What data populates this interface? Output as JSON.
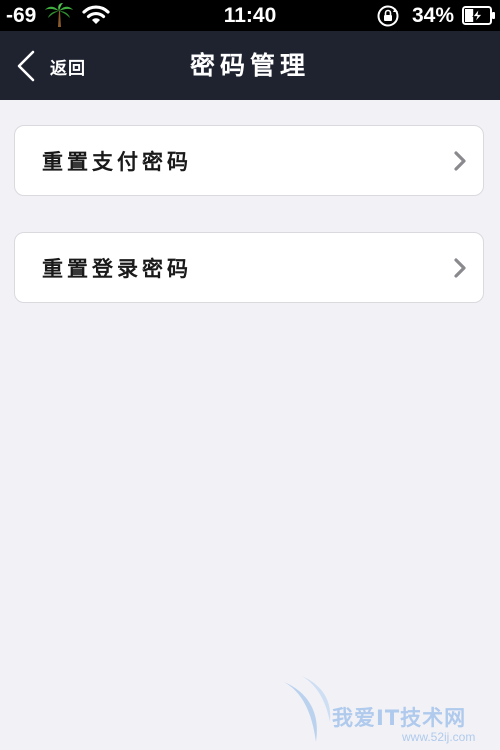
{
  "status_bar": {
    "signal": "-69",
    "carrier_icon": "palm-tree-icon",
    "wifi_icon": "wifi-icon",
    "time": "11:40",
    "lock_icon": "rotation-lock-icon",
    "battery_percent": "34%",
    "battery_icon": "battery-charging-icon",
    "battery_level": 0.34
  },
  "nav_bar": {
    "back_label": "返回",
    "title": "密码管理"
  },
  "menu": {
    "items": [
      {
        "label": "重置支付密码",
        "icon": "chevron-right-icon"
      },
      {
        "label": "重置登录密码",
        "icon": "chevron-right-icon"
      }
    ]
  },
  "watermark": {
    "text": "我爱IT技术网",
    "url": "www.52ij.com"
  },
  "colors": {
    "nav_background": "#1f2330",
    "page_background": "#f2f2f6",
    "card_background": "#ffffff",
    "chevron": "#8a8a8e"
  }
}
